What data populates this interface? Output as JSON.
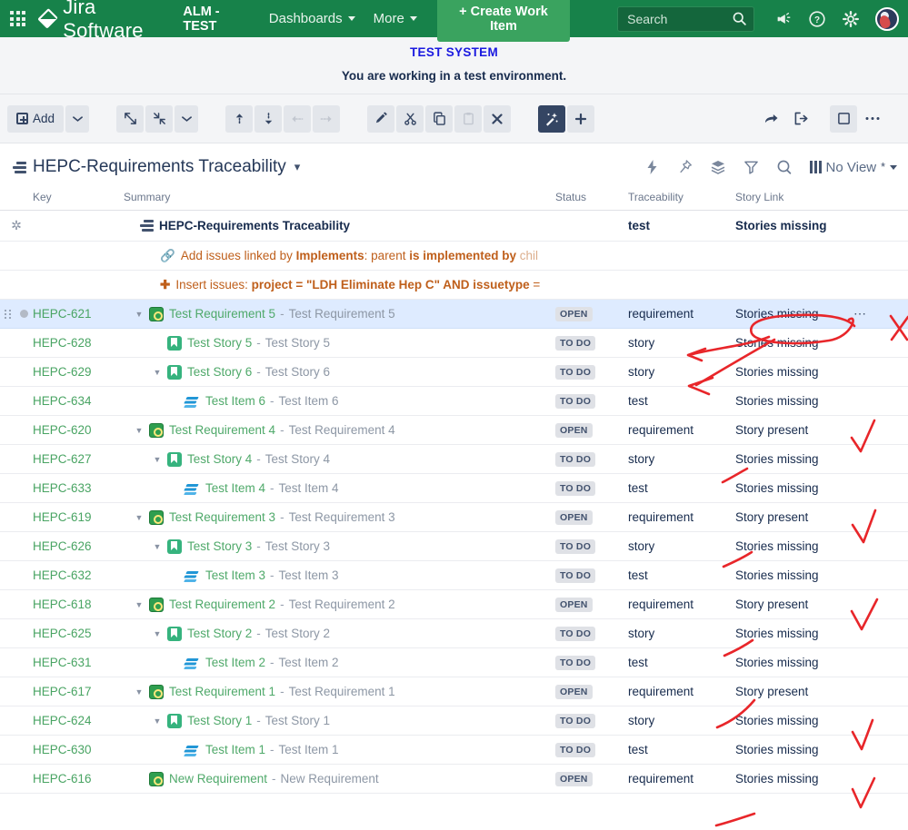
{
  "topnav": {
    "app_switcher": "app-switcher",
    "brand": "Jira Software",
    "project": "ALM - TEST",
    "nav": [
      {
        "label": "Dashboards",
        "caret": true
      },
      {
        "label": "More",
        "caret": true
      }
    ],
    "create_button": "+ Create Work Item",
    "search_placeholder": "Search",
    "search_value": "",
    "icons": [
      "megaphone-icon",
      "help-icon",
      "settings-icon",
      "avatar"
    ]
  },
  "banner": {
    "title": "TEST SYSTEM",
    "message": "You are working in a test environment."
  },
  "toolbar": {
    "add_label": "Add",
    "buttons": [
      "add-button",
      "add-dropdown",
      "expand-all-icon",
      "collapse-all-icon",
      "expand-dropdown",
      "move-up-icon",
      "move-down-icon",
      "outdent-icon",
      "indent-icon",
      "edit-icon",
      "cut-icon",
      "copy-icon",
      "paste-icon",
      "delete-icon",
      "magic-wand-icon",
      "plus-icon",
      "share-icon",
      "export-icon",
      "panel-icon",
      "more-icon"
    ]
  },
  "structure": {
    "title": "HEPC-Requirements Traceability",
    "view_label": "No View",
    "view_modified": "*",
    "right_icons": [
      "automation-icon",
      "pin-icon",
      "layers-icon",
      "filter-icon",
      "search-icon",
      "columns-icon"
    ]
  },
  "table": {
    "columns": [
      "",
      "Key",
      "Summary",
      "Status",
      "Traceability",
      "Story Link",
      ""
    ],
    "root": {
      "summary": "HEPC-Requirements Traceability",
      "traceability": "test",
      "story_link": "Stories missing"
    },
    "generators": [
      {
        "icon": "link-icon",
        "prefix": "Add issues linked by ",
        "bold1": "Implements",
        "mid": ": parent ",
        "bold2": "is implemented by",
        "suffix": " chil"
      },
      {
        "icon": "plus-icon",
        "prefix": "Insert issues: ",
        "bold1": "project = \"LDH Eliminate Hep C\" AND issuetype",
        "mid": " =",
        "bold2": "",
        "suffix": ""
      }
    ],
    "rows": [
      {
        "key": "HEPC-621",
        "indent": 0,
        "twisty": true,
        "type": "req",
        "name": "Test Requirement 5",
        "desc": "Test Requirement 5",
        "status": "OPEN",
        "traceability": "requirement",
        "story_link": "Stories missing",
        "selected": true
      },
      {
        "key": "HEPC-628",
        "indent": 1,
        "twisty": false,
        "type": "story",
        "name": "Test Story 5",
        "desc": "Test Story 5",
        "status": "TO DO",
        "traceability": "story",
        "story_link": "Stories missing",
        "selected": false
      },
      {
        "key": "HEPC-629",
        "indent": 1,
        "twisty": true,
        "type": "story",
        "name": "Test Story 6",
        "desc": "Test Story 6",
        "status": "TO DO",
        "traceability": "story",
        "story_link": "Stories missing",
        "selected": false
      },
      {
        "key": "HEPC-634",
        "indent": 2,
        "twisty": false,
        "type": "test",
        "name": "Test Item 6",
        "desc": "Test Item 6",
        "status": "TO DO",
        "traceability": "test",
        "story_link": "Stories missing",
        "selected": false
      },
      {
        "key": "HEPC-620",
        "indent": 0,
        "twisty": true,
        "type": "req",
        "name": "Test Requirement 4",
        "desc": "Test Requirement 4",
        "status": "OPEN",
        "traceability": "requirement",
        "story_link": "Story present",
        "selected": false
      },
      {
        "key": "HEPC-627",
        "indent": 1,
        "twisty": true,
        "type": "story",
        "name": "Test Story 4",
        "desc": "Test Story 4",
        "status": "TO DO",
        "traceability": "story",
        "story_link": "Stories missing",
        "selected": false
      },
      {
        "key": "HEPC-633",
        "indent": 2,
        "twisty": false,
        "type": "test",
        "name": "Test Item 4",
        "desc": "Test Item 4",
        "status": "TO DO",
        "traceability": "test",
        "story_link": "Stories missing",
        "selected": false
      },
      {
        "key": "HEPC-619",
        "indent": 0,
        "twisty": true,
        "type": "req",
        "name": "Test Requirement 3",
        "desc": "Test Requirement 3",
        "status": "OPEN",
        "traceability": "requirement",
        "story_link": "Story present",
        "selected": false
      },
      {
        "key": "HEPC-626",
        "indent": 1,
        "twisty": true,
        "type": "story",
        "name": "Test Story 3",
        "desc": "Test Story 3",
        "status": "TO DO",
        "traceability": "story",
        "story_link": "Stories missing",
        "selected": false
      },
      {
        "key": "HEPC-632",
        "indent": 2,
        "twisty": false,
        "type": "test",
        "name": "Test Item 3",
        "desc": "Test Item 3",
        "status": "TO DO",
        "traceability": "test",
        "story_link": "Stories missing",
        "selected": false
      },
      {
        "key": "HEPC-618",
        "indent": 0,
        "twisty": true,
        "type": "req",
        "name": "Test Requirement 2",
        "desc": "Test Requirement 2",
        "status": "OPEN",
        "traceability": "requirement",
        "story_link": "Story present",
        "selected": false
      },
      {
        "key": "HEPC-625",
        "indent": 1,
        "twisty": true,
        "type": "story",
        "name": "Test Story 2",
        "desc": "Test Story 2",
        "status": "TO DO",
        "traceability": "story",
        "story_link": "Stories missing",
        "selected": false
      },
      {
        "key": "HEPC-631",
        "indent": 2,
        "twisty": false,
        "type": "test",
        "name": "Test Item 2",
        "desc": "Test Item 2",
        "status": "TO DO",
        "traceability": "test",
        "story_link": "Stories missing",
        "selected": false
      },
      {
        "key": "HEPC-617",
        "indent": 0,
        "twisty": true,
        "type": "req",
        "name": "Test Requirement 1",
        "desc": "Test Requirement 1",
        "status": "OPEN",
        "traceability": "requirement",
        "story_link": "Story present",
        "selected": false
      },
      {
        "key": "HEPC-624",
        "indent": 1,
        "twisty": true,
        "type": "story",
        "name": "Test Story 1",
        "desc": "Test Story 1",
        "status": "TO DO",
        "traceability": "story",
        "story_link": "Stories missing",
        "selected": false
      },
      {
        "key": "HEPC-630",
        "indent": 2,
        "twisty": false,
        "type": "test",
        "name": "Test Item 1",
        "desc": "Test Item 1",
        "status": "TO DO",
        "traceability": "test",
        "story_link": "Stories missing",
        "selected": false
      },
      {
        "key": "HEPC-616",
        "indent": 0,
        "twisty": false,
        "type": "req",
        "name": "New Requirement",
        "desc": "New Requirement",
        "status": "OPEN",
        "traceability": "requirement",
        "story_link": "Stories missing",
        "selected": false
      }
    ]
  },
  "annotations": {
    "color": "#e8262a",
    "marks": [
      "ellipse-around-stories-missing",
      "arrow-to-story-row-628",
      "arrow-to-story-row-629",
      "x-mark-row-621",
      "check-row-620",
      "underline-row-627",
      "check-row-619",
      "underline-row-626",
      "check-row-618",
      "underline-row-625",
      "underline-row-617",
      "check-row-624",
      "check-row-616",
      "underline-row-616"
    ]
  },
  "colors": {
    "nav_green": "#17824a",
    "create_green": "#3aa35f",
    "banner_blue": "#1a19e0",
    "key_green": "#49a463",
    "selected_row": "#deebff",
    "annotation_red": "#e8262a"
  }
}
